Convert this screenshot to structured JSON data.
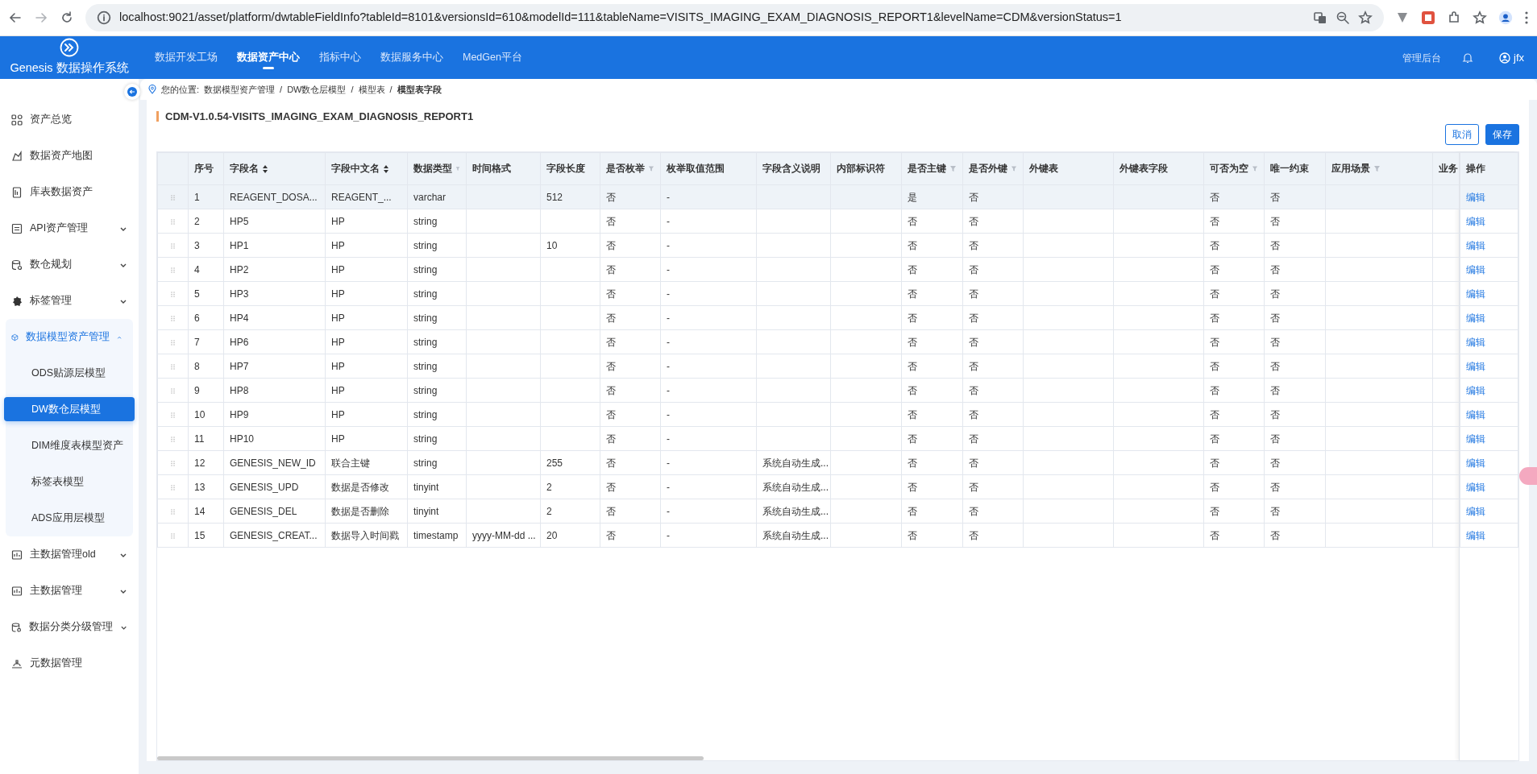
{
  "browser": {
    "url": "localhost:9021/asset/platform/dwtableFieldInfo?tableId=8101&versionsId=610&modelId=111&tableName=VISITS_IMAGING_EXAM_DIAGNOSIS_REPORT1&levelName=CDM&versionStatus=1"
  },
  "app": {
    "title": "Genesis 数据操作系统",
    "nav": [
      {
        "label": "数据开发工场",
        "selected": false
      },
      {
        "label": "数据资产中心",
        "selected": true
      },
      {
        "label": "指标中心",
        "selected": false
      },
      {
        "label": "数据服务中心",
        "selected": false
      },
      {
        "label": "MedGen平台",
        "selected": false
      }
    ],
    "admin": "管理后台",
    "user": "jfx"
  },
  "sidebar": {
    "items": [
      {
        "label": "资产总览",
        "kind": "link",
        "expanded": false
      },
      {
        "label": "数据资产地图",
        "kind": "link",
        "expanded": false
      },
      {
        "label": "库表数据资产",
        "kind": "link",
        "expanded": false
      },
      {
        "label": "API资产管理",
        "kind": "group",
        "expanded": false
      },
      {
        "label": "数仓规划",
        "kind": "group",
        "expanded": false
      },
      {
        "label": "标签管理",
        "kind": "group",
        "expanded": false
      },
      {
        "label": "数据模型资产管理",
        "kind": "group",
        "expanded": true,
        "children": [
          {
            "label": "ODS贴源层模型",
            "selected": false
          },
          {
            "label": "DW数仓层模型",
            "selected": true
          },
          {
            "label": "DIM维度表模型资产",
            "selected": false
          },
          {
            "label": "标签表模型",
            "selected": false
          },
          {
            "label": "ADS应用层模型",
            "selected": false
          }
        ]
      },
      {
        "label": "主数据管理old",
        "kind": "group",
        "expanded": false
      },
      {
        "label": "主数据管理",
        "kind": "group",
        "expanded": false
      },
      {
        "label": "数据分类分级管理",
        "kind": "group",
        "expanded": false
      },
      {
        "label": "元数据管理",
        "kind": "link",
        "expanded": false
      }
    ]
  },
  "breadcrumb": {
    "prefix": "您的位置:",
    "separator": "/",
    "items": [
      "数据模型资产管理",
      "DW数仓层模型",
      "模型表",
      "模型表字段"
    ]
  },
  "panel": {
    "title": "CDM-V1.0.54-VISITS_IMAGING_EXAM_DIAGNOSIS_REPORT1",
    "buttons": [
      {
        "label": "取消",
        "kind": "outline"
      },
      {
        "label": "保存",
        "kind": "primary"
      }
    ]
  },
  "table": {
    "columns": [
      {
        "label": "序号"
      },
      {
        "label": "字段名",
        "sort": true
      },
      {
        "label": "字段中文名",
        "sort": true
      },
      {
        "label": "数据类型",
        "filter": true
      },
      {
        "label": "时间格式"
      },
      {
        "label": "字段长度"
      },
      {
        "label": "是否枚举",
        "filter": true
      },
      {
        "label": "枚举取值范围"
      },
      {
        "label": "字段含义说明"
      },
      {
        "label": "内部标识符"
      },
      {
        "label": "是否主键",
        "filter": true
      },
      {
        "label": "是否外键",
        "filter": true
      },
      {
        "label": "外键表"
      },
      {
        "label": "外键表字段"
      },
      {
        "label": "可否为空",
        "filter": true
      },
      {
        "label": "唯一约束"
      },
      {
        "label": "应用场景",
        "filter": true
      },
      {
        "label": "业务"
      }
    ],
    "action_label": "操作",
    "rows": [
      {
        "hovered": true,
        "action": "编辑",
        "cells": [
          "1",
          "REAGENT_DOSA...",
          "REAGENT_...",
          "varchar",
          null,
          "512",
          "否",
          "-",
          null,
          null,
          "是",
          "否",
          null,
          null,
          "否",
          "否"
        ]
      },
      {
        "hovered": false,
        "action": "编辑",
        "cells": [
          "2",
          "HP5",
          "HP",
          "string",
          null,
          null,
          "否",
          "-",
          null,
          null,
          "否",
          "否",
          null,
          null,
          "否",
          "否"
        ]
      },
      {
        "hovered": false,
        "action": "编辑",
        "cells": [
          "3",
          "HP1",
          "HP",
          "string",
          null,
          "10",
          "否",
          "-",
          null,
          null,
          "否",
          "否",
          null,
          null,
          "否",
          "否"
        ]
      },
      {
        "hovered": false,
        "action": "编辑",
        "cells": [
          "4",
          "HP2",
          "HP",
          "string",
          null,
          null,
          "否",
          "-",
          null,
          null,
          "否",
          "否",
          null,
          null,
          "否",
          "否"
        ]
      },
      {
        "hovered": false,
        "action": "编辑",
        "cells": [
          "5",
          "HP3",
          "HP",
          "string",
          null,
          null,
          "否",
          "-",
          null,
          null,
          "否",
          "否",
          null,
          null,
          "否",
          "否"
        ]
      },
      {
        "hovered": false,
        "action": "编辑",
        "cells": [
          "6",
          "HP4",
          "HP",
          "string",
          null,
          null,
          "否",
          "-",
          null,
          null,
          "否",
          "否",
          null,
          null,
          "否",
          "否"
        ]
      },
      {
        "hovered": false,
        "action": "编辑",
        "cells": [
          "7",
          "HP6",
          "HP",
          "string",
          null,
          null,
          "否",
          "-",
          null,
          null,
          "否",
          "否",
          null,
          null,
          "否",
          "否"
        ]
      },
      {
        "hovered": false,
        "action": "编辑",
        "cells": [
          "8",
          "HP7",
          "HP",
          "string",
          null,
          null,
          "否",
          "-",
          null,
          null,
          "否",
          "否",
          null,
          null,
          "否",
          "否"
        ]
      },
      {
        "hovered": false,
        "action": "编辑",
        "cells": [
          "9",
          "HP8",
          "HP",
          "string",
          null,
          null,
          "否",
          "-",
          null,
          null,
          "否",
          "否",
          null,
          null,
          "否",
          "否"
        ]
      },
      {
        "hovered": false,
        "action": "编辑",
        "cells": [
          "10",
          "HP9",
          "HP",
          "string",
          null,
          null,
          "否",
          "-",
          null,
          null,
          "否",
          "否",
          null,
          null,
          "否",
          "否"
        ]
      },
      {
        "hovered": false,
        "action": "编辑",
        "cells": [
          "11",
          "HP10",
          "HP",
          "string",
          null,
          null,
          "否",
          "-",
          null,
          null,
          "否",
          "否",
          null,
          null,
          "否",
          "否"
        ]
      },
      {
        "hovered": false,
        "action": "编辑",
        "cells": [
          "12",
          "GENESIS_NEW_ID",
          "联合主键",
          "string",
          null,
          "255",
          "否",
          "-",
          "系统自动生成...",
          null,
          "否",
          "否",
          null,
          null,
          "否",
          "否"
        ]
      },
      {
        "hovered": false,
        "action": "编辑",
        "cells": [
          "13",
          "GENESIS_UPD",
          "数据是否修改",
          "tinyint",
          null,
          "2",
          "否",
          "-",
          "系统自动生成...",
          null,
          "否",
          "否",
          null,
          null,
          "否",
          "否"
        ]
      },
      {
        "hovered": false,
        "action": "编辑",
        "cells": [
          "14",
          "GENESIS_DEL",
          "数据是否删除",
          "tinyint",
          null,
          "2",
          "否",
          "-",
          "系统自动生成...",
          null,
          "否",
          "否",
          null,
          null,
          "否",
          "否"
        ]
      },
      {
        "hovered": false,
        "action": "编辑",
        "cells": [
          "15",
          "GENESIS_CREAT...",
          "数据导入时间戳",
          "timestamp",
          "yyyy-MM-dd ...",
          "20",
          "否",
          "-",
          "系统自动生成...",
          null,
          "否",
          "否",
          null,
          null,
          "否",
          "否"
        ]
      }
    ]
  }
}
